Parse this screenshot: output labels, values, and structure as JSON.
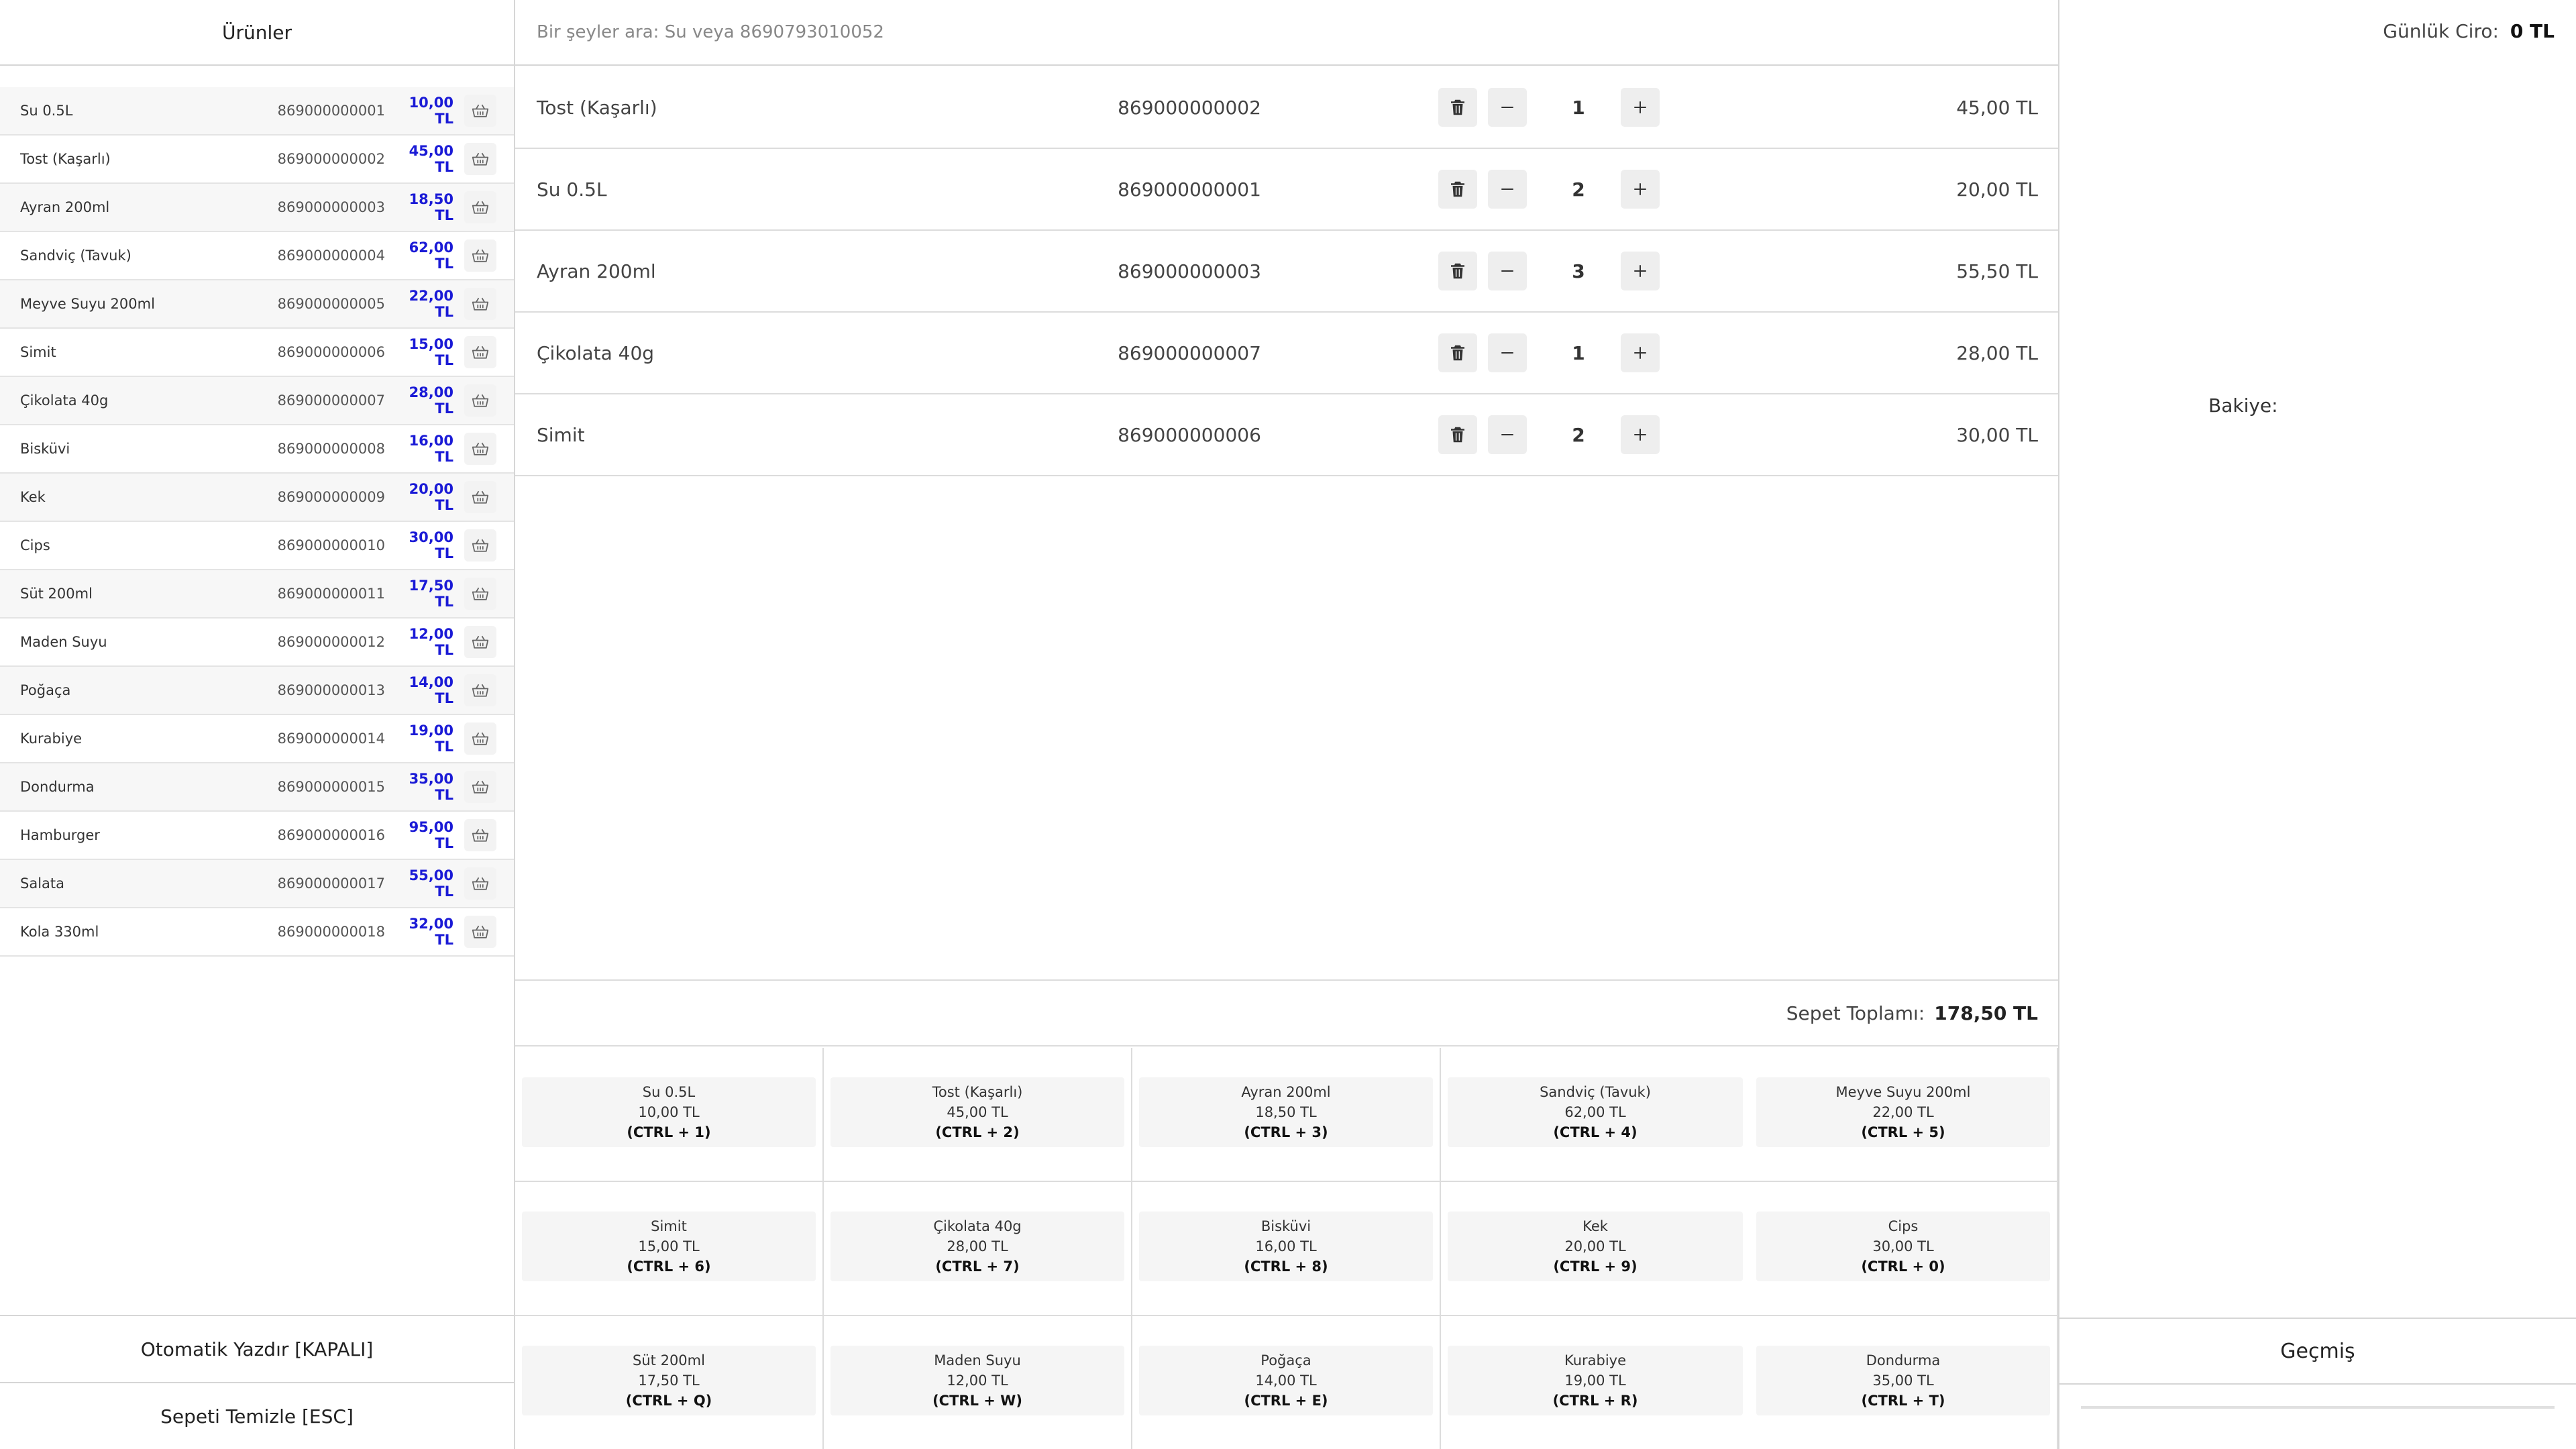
{
  "left": {
    "header": "Ürünler",
    "products": [
      {
        "name": "Su 0.5L",
        "barcode": "869000000001",
        "price": "10,00 TL"
      },
      {
        "name": "Tost (Kaşarlı)",
        "barcode": "869000000002",
        "price": "45,00 TL"
      },
      {
        "name": "Ayran 200ml",
        "barcode": "869000000003",
        "price": "18,50 TL"
      },
      {
        "name": "Sandviç (Tavuk)",
        "barcode": "869000000004",
        "price": "62,00 TL"
      },
      {
        "name": "Meyve Suyu 200ml",
        "barcode": "869000000005",
        "price": "22,00 TL"
      },
      {
        "name": "Simit",
        "barcode": "869000000006",
        "price": "15,00 TL"
      },
      {
        "name": "Çikolata 40g",
        "barcode": "869000000007",
        "price": "28,00 TL"
      },
      {
        "name": "Bisküvi",
        "barcode": "869000000008",
        "price": "16,00 TL"
      },
      {
        "name": "Kek",
        "barcode": "869000000009",
        "price": "20,00 TL"
      },
      {
        "name": "Cips",
        "barcode": "869000000010",
        "price": "30,00 TL"
      },
      {
        "name": "Süt 200ml",
        "barcode": "869000000011",
        "price": "17,50 TL"
      },
      {
        "name": "Maden Suyu",
        "barcode": "869000000012",
        "price": "12,00 TL"
      },
      {
        "name": "Poğaça",
        "barcode": "869000000013",
        "price": "14,00 TL"
      },
      {
        "name": "Kurabiye",
        "barcode": "869000000014",
        "price": "19,00 TL"
      },
      {
        "name": "Dondurma",
        "barcode": "869000000015",
        "price": "35,00 TL"
      },
      {
        "name": "Hamburger",
        "barcode": "869000000016",
        "price": "95,00 TL"
      },
      {
        "name": "Salata",
        "barcode": "869000000017",
        "price": "55,00 TL"
      },
      {
        "name": "Kola 330ml",
        "barcode": "869000000018",
        "price": "32,00 TL"
      }
    ],
    "auto_print_label": "Otomatik Yazdır [KAPALI]",
    "clear_cart_label": "Sepeti Temizle [ESC]"
  },
  "center": {
    "search_placeholder": "Bir şeyler ara: Su veya 8690793010052",
    "cart": [
      {
        "name": "Tost (Kaşarlı)",
        "barcode": "869000000002",
        "qty": "1",
        "total": "45,00 TL"
      },
      {
        "name": "Su 0.5L",
        "barcode": "869000000001",
        "qty": "2",
        "total": "20,00 TL"
      },
      {
        "name": "Ayran 200ml",
        "barcode": "869000000003",
        "qty": "3",
        "total": "55,50 TL"
      },
      {
        "name": "Çikolata 40g",
        "barcode": "869000000007",
        "qty": "1",
        "total": "28,00 TL"
      },
      {
        "name": "Simit",
        "barcode": "869000000006",
        "qty": "2",
        "total": "30,00 TL"
      }
    ],
    "cart_total_label": "Sepet Toplamı:",
    "cart_total_value": "178,50 TL",
    "quick_buttons": [
      {
        "name": "Su 0.5L",
        "price": "10,00 TL",
        "shortcut": "(CTRL + 1)"
      },
      {
        "name": "Tost (Kaşarlı)",
        "price": "45,00 TL",
        "shortcut": "(CTRL + 2)"
      },
      {
        "name": "Ayran 200ml",
        "price": "18,50 TL",
        "shortcut": "(CTRL + 3)"
      },
      {
        "name": "Sandviç (Tavuk)",
        "price": "62,00 TL",
        "shortcut": "(CTRL + 4)"
      },
      {
        "name": "Meyve Suyu 200ml",
        "price": "22,00 TL",
        "shortcut": "(CTRL + 5)"
      },
      {
        "name": "Simit",
        "price": "15,00 TL",
        "shortcut": "(CTRL + 6)"
      },
      {
        "name": "Çikolata 40g",
        "price": "28,00 TL",
        "shortcut": "(CTRL + 7)"
      },
      {
        "name": "Bisküvi",
        "price": "16,00 TL",
        "shortcut": "(CTRL + 8)"
      },
      {
        "name": "Kek",
        "price": "20,00 TL",
        "shortcut": "(CTRL + 9)"
      },
      {
        "name": "Cips",
        "price": "30,00 TL",
        "shortcut": "(CTRL + 0)"
      },
      {
        "name": "Süt 200ml",
        "price": "17,50 TL",
        "shortcut": "(CTRL + Q)"
      },
      {
        "name": "Maden Suyu",
        "price": "12,00 TL",
        "shortcut": "(CTRL + W)"
      },
      {
        "name": "Poğaça",
        "price": "14,00 TL",
        "shortcut": "(CTRL + E)"
      },
      {
        "name": "Kurabiye",
        "price": "19,00 TL",
        "shortcut": "(CTRL + R)"
      },
      {
        "name": "Dondurma",
        "price": "35,00 TL",
        "shortcut": "(CTRL + T)"
      }
    ]
  },
  "right": {
    "daily_revenue_label": "Günlük Ciro:",
    "daily_revenue_value": "0 TL",
    "balance_label": "Bakiye:",
    "history_label": "Geçmiş"
  },
  "icons": {
    "cart": "basket-icon",
    "delete": "trash-icon",
    "minus": "minus-icon",
    "plus": "plus-icon"
  },
  "colors": {
    "price_accent": "#1a1ad6",
    "border": "#d6d6d6",
    "button_bg": "#eeeeee"
  }
}
